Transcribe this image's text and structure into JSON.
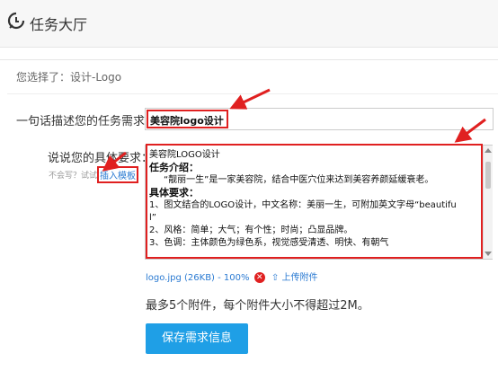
{
  "header": {
    "title": "任务大厅"
  },
  "selection": {
    "text": "您选择了：设计-Logo"
  },
  "task": {
    "label": "一句话描述您的任务需求：",
    "value": "美容院logo设计"
  },
  "requirements": {
    "label": "说说您的具体要求：",
    "hint": "不会写？试试",
    "template_link": "插入模板",
    "lines": [
      "美容院LOGO设计",
      "任务介绍：",
      "“靓丽一生”是一家美容院，结合中医穴位来达到美容养颜延缓衰老。",
      "具体要求：",
      "1、图文结合的LOGO设计，中文名称：美丽一生，可附加英文字母“beautifu",
      "l”",
      "2、风格：简单；大气；有个性；时尚；凸显品牌。",
      "3、色调：主体颜色为绿色系，视觉感受清透、明快、有朝气"
    ]
  },
  "attachment": {
    "file": "logo.jpg (26KB) - 100%",
    "upload_label": "上传附件"
  },
  "limit_text": "最多5个附件，每个附件大小不得超过2M。",
  "save_button": "保存需求信息",
  "colors": {
    "accent": "#1f9fe6",
    "highlight": "#e02020",
    "link": "#2a7ad2"
  }
}
